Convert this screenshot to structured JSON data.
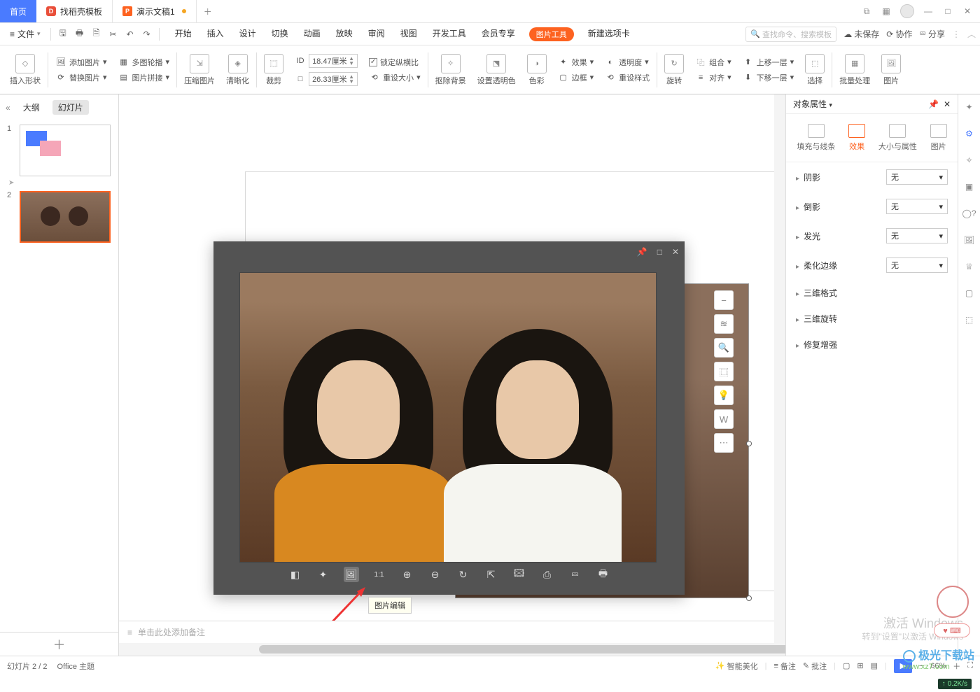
{
  "titlebar": {
    "home": "首页",
    "tab1": "找稻壳模板",
    "tab2": "演示文稿1"
  },
  "menubar": {
    "file": "文件",
    "tabs": [
      "开始",
      "插入",
      "设计",
      "切换",
      "动画",
      "放映",
      "审阅",
      "视图",
      "开发工具",
      "会员专享"
    ],
    "pic_tools": "图片工具",
    "new_tab": "新建选项卡",
    "search_placeholder": "查找命令、搜索模板",
    "unsaved": "未保存",
    "coop": "协作",
    "share": "分享"
  },
  "ribbon": {
    "insert_shape": "插入形状",
    "add_image": "添加图片",
    "multi_outline": "多图轮播",
    "replace_image": "替换图片",
    "image_stitch": "图片拼接",
    "compress": "压缩图片",
    "sharpen": "清晰化",
    "crop": "裁剪",
    "width": "18.47厘米",
    "height": "26.33厘米",
    "lock_ratio": "锁定纵横比",
    "reset_size": "重设大小",
    "remove_bg": "抠除背景",
    "set_transparent": "设置透明色",
    "color": "色彩",
    "effect": "效果",
    "transparency": "透明度",
    "border": "边框",
    "reset_style": "重设样式",
    "rotate": "旋转",
    "combine": "组合",
    "align": "对齐",
    "move_up": "上移一层",
    "move_down": "下移一层",
    "select": "选择",
    "batch": "批量处理",
    "image": "图片"
  },
  "slidepanel": {
    "outline": "大纲",
    "slides": "幻灯片",
    "n1": "1",
    "n2": "2"
  },
  "imgwin": {
    "tooltip": "图片编辑",
    "t_flip": "对比",
    "t_magic": "魔法",
    "t_edit": "编辑",
    "t_11": "1:1",
    "t_zoomin": "放大",
    "t_zoomout": "缩小",
    "t_rotate": "旋转",
    "t_a": "a",
    "t_b": "b",
    "t_c": "c",
    "t_d": "d",
    "t_e": "e"
  },
  "notes_placeholder": "单击此处添加备注",
  "props": {
    "title": "对象属性",
    "tab_fill": "填充与线条",
    "tab_effect": "效果",
    "tab_size": "大小与属性",
    "tab_image": "图片",
    "shadow": "阴影",
    "reflection": "倒影",
    "glow": "发光",
    "soft_edges": "柔化边缘",
    "3d_format": "三维格式",
    "3d_rotation": "三维旋转",
    "restore_enhance": "修复增强",
    "none": "无"
  },
  "status": {
    "slide": "幻灯片 2 / 2",
    "theme": "Office 主题",
    "smart": "智能美化",
    "notes": "备注",
    "comments": "批注",
    "zoom": "66%"
  },
  "watermark": {
    "l1": "激活 Windows",
    "l2": "转到\"设置\"以激活 Windows",
    "site": "极光下载站",
    "url": "www.xz7.com",
    "speed": "0.2K/s"
  }
}
